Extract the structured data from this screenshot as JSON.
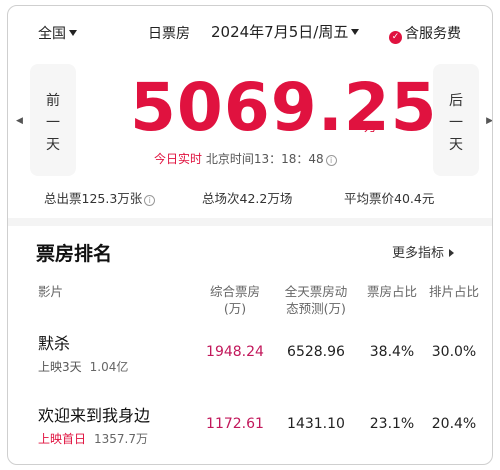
{
  "topbar": {
    "region": "全国",
    "mode": "日票房",
    "date": "2024年7月5日/周五",
    "service_fee": "含服务费"
  },
  "nav": {
    "prev_day": [
      "前",
      "一",
      "天"
    ],
    "next_day": [
      "后",
      "一",
      "天"
    ]
  },
  "box_office": {
    "value": "5069.25",
    "unit": "万",
    "realtime_label": "今日实时",
    "clock": "北京时间13：18：48"
  },
  "stats": {
    "tickets": "总出票125.3万张",
    "shows": "总场次42.2万场",
    "avg_price": "平均票价40.4元"
  },
  "ranking": {
    "title": "票房排名",
    "more_label": "更多指标",
    "columns": {
      "film": "影片",
      "box": "综合票房\n(万)",
      "pred": "全天票房动\n态预测(万)",
      "share": "票房占比",
      "sched": "排片占比"
    },
    "rows": [
      {
        "name": "默杀",
        "days": "上映3天",
        "total": "1.04亿",
        "box": "1948.24",
        "pred": "6528.96",
        "share": "38.4%",
        "sched": "30.0%"
      },
      {
        "name": "欢迎来到我身边",
        "days": "上映首日",
        "total": "1357.7万",
        "box": "1172.61",
        "pred": "1431.10",
        "share": "23.1%",
        "sched": "20.4%"
      }
    ]
  },
  "colors": {
    "accent": "#e0123f",
    "box_value": "#c2185b"
  }
}
